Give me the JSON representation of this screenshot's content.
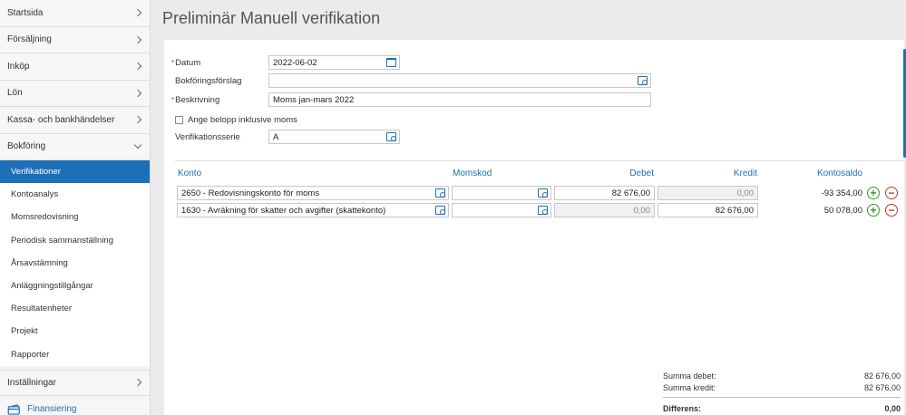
{
  "sidebar": {
    "top_items": [
      "Startsida",
      "Försäljning",
      "Inköp",
      "Lön",
      "Kassa- och bankhändelser",
      "Bokföring"
    ],
    "sub_items": [
      "Verifikationer",
      "Kontoanalys",
      "Momsredovisning",
      "Periodisk sammanställning",
      "Årsavstämning",
      "Anläggningstillgångar",
      "Resultatenheter",
      "Projekt",
      "Rapporter"
    ],
    "active_sub": "Verifikationer",
    "bottom_items": [
      "Inställningar",
      "Finansiering"
    ]
  },
  "page": {
    "title": "Preliminär Manuell verifikation"
  },
  "form": {
    "datum_label": "Datum",
    "datum_value": "2022-06-02",
    "bokforingsforslag_label": "Bokföringsförslag",
    "bokforingsforslag_value": "",
    "beskrivning_label": "Beskrivning",
    "beskrivning_value": "Moms jan-mars 2022",
    "inklusive_moms_label": "Ange belopp inklusive moms",
    "inklusive_moms_checked": false,
    "serie_label": "Verifikationsserie",
    "serie_value": "A",
    "required_mark": "*"
  },
  "table": {
    "headers": {
      "konto": "Konto",
      "momskod": "Momskod",
      "debet": "Debet",
      "kredit": "Kredit",
      "kontosaldo": "Kontosaldo"
    },
    "rows": [
      {
        "konto": "2650 - Redovisningskonto för moms",
        "momskod": "",
        "debet": "82 676,00",
        "kredit": "0,00",
        "kontosaldo": "-93 354,00"
      },
      {
        "konto": "1630 - Avräkning för skatter och avgifter (skattekonto)",
        "momskod": "",
        "debet": "0,00",
        "kredit": "82 676,00",
        "kontosaldo": "50 078,00"
      }
    ],
    "add_symbol": "+",
    "remove_symbol": "−"
  },
  "summary": {
    "debet_label": "Summa debet:",
    "debet_value": "82 676,00",
    "kredit_label": "Summa kredit:",
    "kredit_value": "82 676,00",
    "diff_label": "Differens:",
    "diff_value": "0,00"
  },
  "colors": {
    "accent": "#1d6fb8",
    "add": "#3a9a2d",
    "remove": "#c0392b"
  }
}
